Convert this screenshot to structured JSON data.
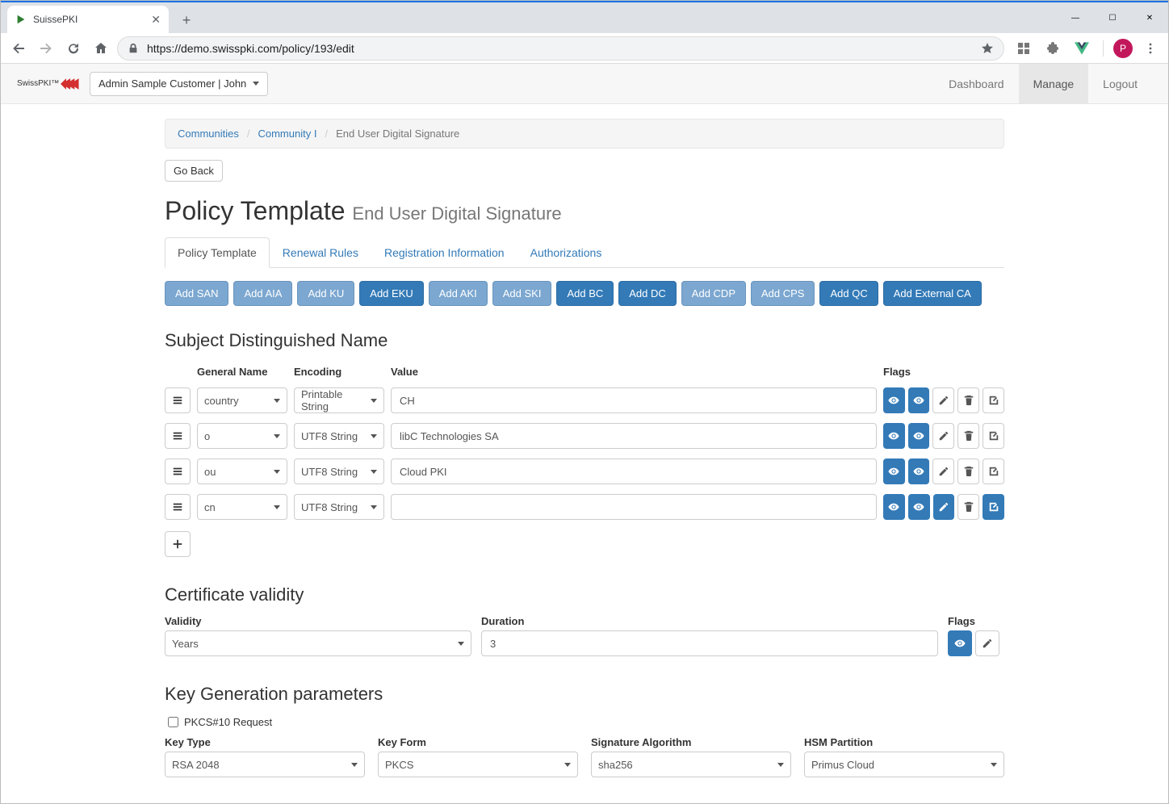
{
  "browser": {
    "tab_title": "SuissePKI",
    "url": "https://demo.swisspki.com/policy/193/edit",
    "avatar_initial": "P"
  },
  "app": {
    "brand": "SwissPKI™",
    "user_dropdown": "Admin Sample Customer | John",
    "nav": {
      "dashboard": "Dashboard",
      "manage": "Manage",
      "logout": "Logout"
    }
  },
  "breadcrumb": {
    "communities": "Communities",
    "community": "Community I",
    "active": "End User Digital Signature"
  },
  "go_back": "Go Back",
  "page": {
    "title": "Policy Template",
    "subtitle": "End User Digital Signature"
  },
  "tabs": {
    "policy_template": "Policy Template",
    "renewal_rules": "Renewal Rules",
    "registration_info": "Registration Information",
    "authorizations": "Authorizations"
  },
  "add_buttons": {
    "san": "Add SAN",
    "aia": "Add AIA",
    "ku": "Add KU",
    "eku": "Add EKU",
    "aki": "Add AKI",
    "ski": "Add SKI",
    "bc": "Add BC",
    "dc": "Add DC",
    "cdp": "Add CDP",
    "cps": "Add CPS",
    "qc": "Add QC",
    "ext_ca": "Add External CA"
  },
  "sdn": {
    "heading": "Subject Distinguished Name",
    "headers": {
      "name": "General Name",
      "encoding": "Encoding",
      "value": "Value",
      "flags": "Flags"
    },
    "rows": [
      {
        "name": "country",
        "encoding": "Printable String",
        "value": "CH",
        "flags": [
          "blue-eye",
          "blue-eye",
          "white-pencil",
          "white-trash",
          "white-edit"
        ]
      },
      {
        "name": "o",
        "encoding": "UTF8 String",
        "value": "libC Technologies SA",
        "flags": [
          "blue-eye",
          "blue-eye",
          "white-pencil",
          "white-trash",
          "white-edit"
        ]
      },
      {
        "name": "ou",
        "encoding": "UTF8 String",
        "value": "Cloud PKI",
        "flags": [
          "blue-eye",
          "blue-eye",
          "white-pencil",
          "white-trash",
          "white-edit"
        ]
      },
      {
        "name": "cn",
        "encoding": "UTF8 String",
        "value": "",
        "flags": [
          "blue-eye",
          "blue-eye",
          "blue-pencil",
          "white-trash",
          "blue-edit"
        ]
      }
    ]
  },
  "validity": {
    "heading": "Certificate validity",
    "validity_label": "Validity",
    "validity_value": "Years",
    "duration_label": "Duration",
    "duration_value": "3",
    "flags_label": "Flags"
  },
  "keygen": {
    "heading": "Key Generation parameters",
    "pkcs10_label": "PKCS#10 Request",
    "key_type_label": "Key Type",
    "key_type_value": "RSA 2048",
    "key_form_label": "Key Form",
    "key_form_value": "PKCS",
    "sig_alg_label": "Signature Algorithm",
    "sig_alg_value": "sha256",
    "hsm_label": "HSM Partition",
    "hsm_value": "Primus Cloud"
  }
}
